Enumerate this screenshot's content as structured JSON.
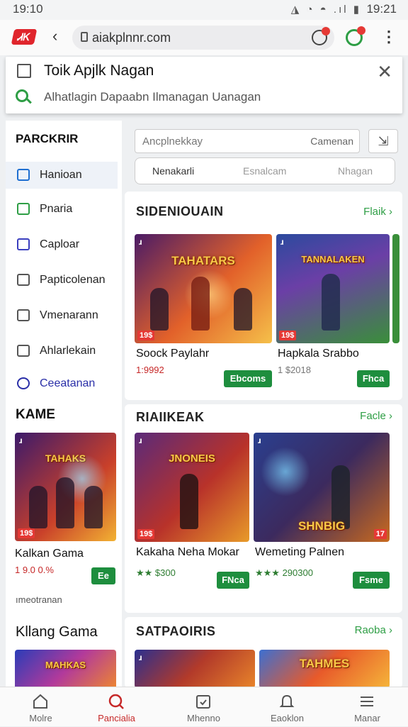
{
  "status_bar": {
    "time_left": "19:10",
    "time_right": "19:21",
    "icons": "◮ ◔ ◓ .ıl ▮"
  },
  "browser": {
    "logo_text": "ᏗᏦ",
    "back_icon": "‹",
    "url": "aiakplnnr.com",
    "menu_icon": "⋮"
  },
  "find_panel": {
    "title": "Toik Apjlk Nagan",
    "subtitle": "Alhatlagin Dapaabn Ilmanagan Uanagan"
  },
  "sidebar": {
    "heading": "PARCKRIR",
    "items": [
      {
        "label": "Hanioan",
        "color": "#1f6fd1"
      },
      {
        "label": "Pnaria",
        "color": "#2e9e45"
      },
      {
        "label": "Caploar",
        "color": "#3b3fbf"
      },
      {
        "label": "Papticolenan",
        "color": "#555555"
      },
      {
        "label": "Vmenarann",
        "color": "#555555"
      },
      {
        "label": "Ahlarlekain",
        "color": "#555555"
      },
      {
        "label": "Ceeatanan",
        "color": "#2a2fa8"
      }
    ],
    "game_heading": "KAME",
    "game_card": {
      "title": "Kalkan Gama",
      "price": "1 9.0 0.%",
      "button": "Ee",
      "tag": "19$"
    },
    "link_text": "ımeotranan",
    "bottom_heading": "Kllang Gama"
  },
  "main": {
    "search_placeholder": "Ancplnekkay",
    "search_right": "Camenan",
    "filter_icon": "⇲",
    "segments": [
      "Nenakarli",
      "Esnalcam",
      "Nhagan"
    ],
    "sections": [
      {
        "title": "SIDENIOUAIN",
        "more": "Flaik ›",
        "cards": [
          {
            "title": "Soock Paylahr",
            "price": "1:9992",
            "button": "Ebcoms",
            "tag": "19$",
            "logo": "TAHATARS"
          },
          {
            "title": "Hapkala Srabbo",
            "price": "1 $2018",
            "button": "Fhca",
            "tag": "19$",
            "logo": "TANNALAKEN"
          }
        ]
      },
      {
        "title": "RIAIIKEAK",
        "more": "Facle ›",
        "cards": [
          {
            "title": "Kakaha Neha Mokar",
            "price": "★★ $300",
            "button": "FNca",
            "tag": "19$",
            "logo": "JNONEIS"
          },
          {
            "title": "Wemeting Palnen",
            "price": "★★★ 290300",
            "button": "Fsme",
            "tag": "17",
            "logo": "SHNBIG"
          }
        ]
      },
      {
        "title": "SATPAOIRIS",
        "more": "Raoba ›",
        "cards": [
          {
            "title": "",
            "price": "",
            "button": "",
            "tag": "",
            "logo": ""
          },
          {
            "title": "",
            "price": "",
            "button": "",
            "tag": "",
            "logo": "TAHMES"
          }
        ]
      }
    ]
  },
  "bottom_nav": [
    {
      "label": "Molre",
      "icon": "home-icon"
    },
    {
      "label": "Pancialia",
      "icon": "search-icon"
    },
    {
      "label": "Mhenno",
      "icon": "calendar-icon"
    },
    {
      "label": "Eaoklon",
      "icon": "bell-icon"
    },
    {
      "label": "Manar",
      "icon": "menu-icon"
    }
  ],
  "colors": {
    "accent_green": "#2e9e45",
    "accent_red": "#c62828",
    "button_green": "#1e8e3e"
  }
}
